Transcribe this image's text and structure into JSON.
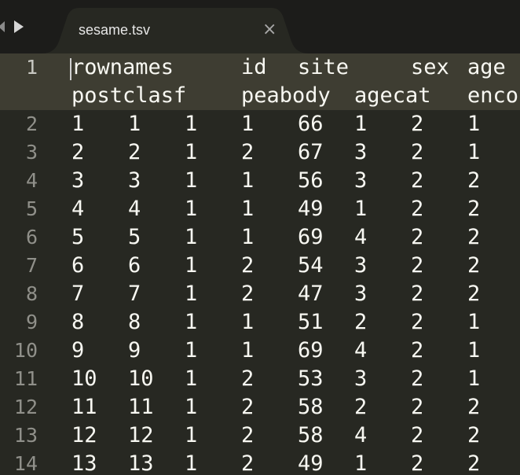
{
  "tab": {
    "title": "sesame.tsv",
    "close_glyph": "×"
  },
  "icons": {
    "back": "back-arrow-icon",
    "forward": "forward-arrow-icon",
    "close": "close-icon"
  },
  "colors": {
    "background": "#272822",
    "active_line": "#3e3d32",
    "text": "#f8f8f2",
    "gutter_text": "#90908a",
    "tabbar": "#1c1c1a",
    "tab": "#272822"
  },
  "active_line_number": 1,
  "lines": [
    {
      "number": "1",
      "wrap": [
        [
          "rownames",
          "id",
          "site",
          "sex",
          "age"
        ],
        [
          "postclasf",
          "peabody",
          "agecat",
          "enco"
        ]
      ]
    },
    {
      "number": "2",
      "cells": [
        "1",
        "1",
        "1",
        "1",
        "66",
        "1",
        "2",
        "1"
      ]
    },
    {
      "number": "3",
      "cells": [
        "2",
        "2",
        "1",
        "2",
        "67",
        "3",
        "2",
        "1"
      ]
    },
    {
      "number": "4",
      "cells": [
        "3",
        "3",
        "1",
        "1",
        "56",
        "3",
        "2",
        "2"
      ]
    },
    {
      "number": "5",
      "cells": [
        "4",
        "4",
        "1",
        "1",
        "49",
        "1",
        "2",
        "2"
      ]
    },
    {
      "number": "6",
      "cells": [
        "5",
        "5",
        "1",
        "1",
        "69",
        "4",
        "2",
        "2"
      ]
    },
    {
      "number": "7",
      "cells": [
        "6",
        "6",
        "1",
        "2",
        "54",
        "3",
        "2",
        "2"
      ]
    },
    {
      "number": "8",
      "cells": [
        "7",
        "7",
        "1",
        "2",
        "47",
        "3",
        "2",
        "2"
      ]
    },
    {
      "number": "9",
      "cells": [
        "8",
        "8",
        "1",
        "1",
        "51",
        "2",
        "2",
        "1"
      ]
    },
    {
      "number": "10",
      "cells": [
        "9",
        "9",
        "1",
        "1",
        "69",
        "4",
        "2",
        "1"
      ]
    },
    {
      "number": "11",
      "cells": [
        "10",
        "10",
        "1",
        "2",
        "53",
        "3",
        "2",
        "1"
      ]
    },
    {
      "number": "12",
      "cells": [
        "11",
        "11",
        "1",
        "2",
        "58",
        "2",
        "2",
        "2"
      ]
    },
    {
      "number": "13",
      "cells": [
        "12",
        "12",
        "1",
        "2",
        "58",
        "4",
        "2",
        "2"
      ]
    },
    {
      "number": "14",
      "cells": [
        "13",
        "13",
        "1",
        "2",
        "49",
        "1",
        "2",
        "2"
      ]
    }
  ]
}
